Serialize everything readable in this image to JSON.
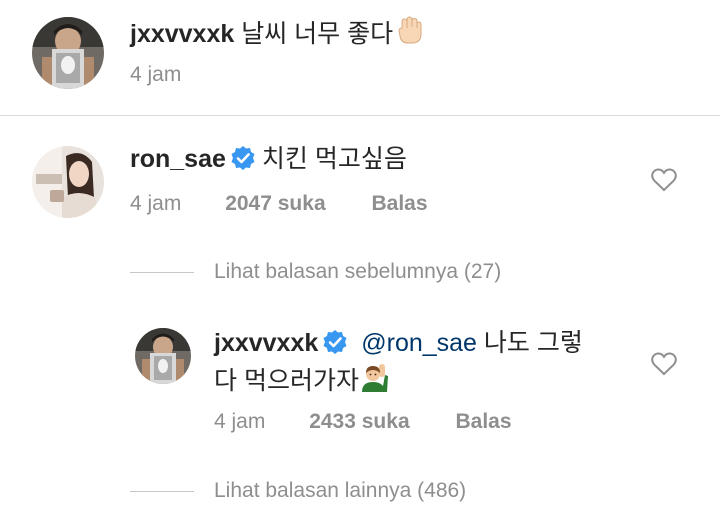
{
  "comments": [
    {
      "username": "jxxvvxxk",
      "text": "날씨 너무 좋다",
      "emoji": "raised-fist-emoji",
      "time": "4 jam"
    },
    {
      "username": "ron_sae",
      "verified": true,
      "text": "치킨 먹고싶음",
      "time": "4 jam",
      "likes": "2047 suka",
      "reply_label": "Balas",
      "view_previous": "Lihat balasan sebelumnya (27)",
      "reply": {
        "username": "jxxvvxxk",
        "verified": true,
        "mention": "@ron_sae",
        "text_line1": "나도 그렇",
        "text_line2": "다 먹으러가자",
        "emoji": "person-raising-hand-emoji",
        "time": "4 jam",
        "likes": "2433 suka",
        "reply_label": "Balas"
      },
      "view_more": "Lihat balasan lainnya (486)"
    }
  ],
  "icons": {
    "like": "heart-outline-icon",
    "verified": "verified-badge-icon"
  },
  "colors": {
    "verified_blue": "#3897f0",
    "mention": "#00376b",
    "muted": "#8e8e8e"
  }
}
